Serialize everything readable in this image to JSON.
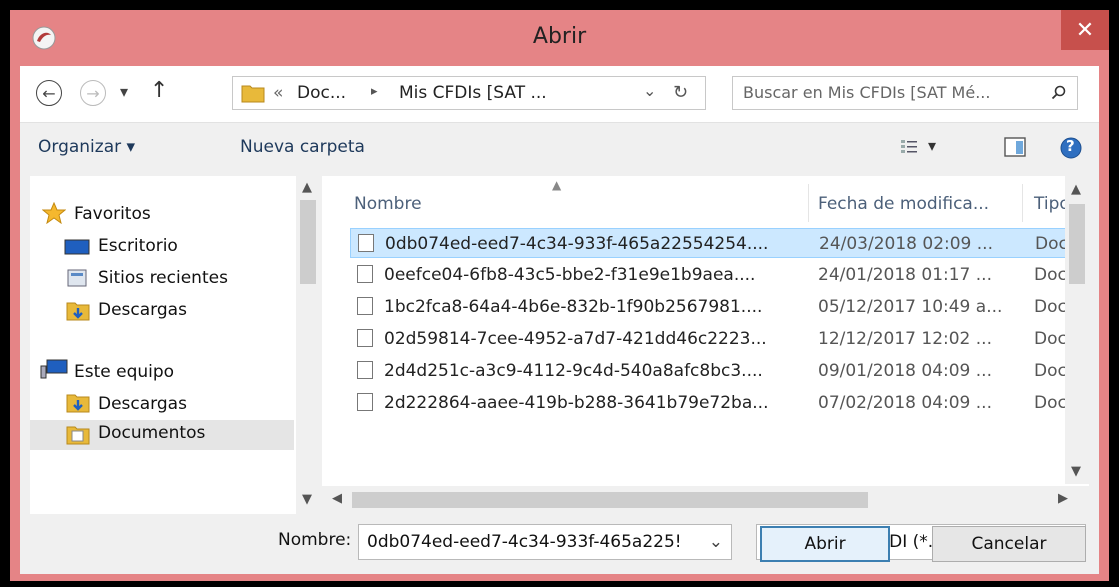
{
  "window": {
    "title": "Abrir",
    "close_glyph": "✕"
  },
  "nav": {
    "back_glyph": "←",
    "forward_glyph": "→",
    "recent_glyph": "▾",
    "up_glyph": "↑",
    "address_prefix": "«",
    "crumb1": "Doc...",
    "crumb_sep": "▸",
    "crumb2": "Mis CFDIs [SAT ...",
    "address_dropdown_glyph": "⌄",
    "refresh_glyph": "↻",
    "search_placeholder": "Buscar en Mis CFDIs [SAT Mé..."
  },
  "toolbar": {
    "organize_label": "Organizar ▾",
    "new_folder_label": "Nueva carpeta",
    "view_dropdown_glyph": "▾",
    "help_glyph": "?"
  },
  "sidebar": {
    "favorites": "Favoritos",
    "items": [
      {
        "label": "Escritorio"
      },
      {
        "label": "Sitios recientes"
      },
      {
        "label": "Descargas"
      }
    ],
    "computer": "Este equipo",
    "computer_items": [
      {
        "label": "Descargas"
      },
      {
        "label": "Documentos"
      }
    ]
  },
  "file_list": {
    "columns": {
      "name": "Nombre",
      "date": "Fecha de modifica...",
      "type": "Tipo"
    },
    "rows": [
      {
        "name": "0db074ed-eed7-4c34-933f-465a22554254....",
        "date": "24/03/2018 02:09 ...",
        "type": "Docun",
        "selected": true
      },
      {
        "name": "0eefce04-6fb8-43c5-bbe2-f31e9e1b9aea....",
        "date": "24/01/2018 01:17 ...",
        "type": "Docun",
        "selected": false
      },
      {
        "name": "1bc2fca8-64a4-4b6e-832b-1f90b2567981....",
        "date": "05/12/2017 10:49 a...",
        "type": "Docun",
        "selected": false
      },
      {
        "name": "02d59814-7cee-4952-a7d7-421dd46c2223...",
        "date": "12/12/2017 12:02 ...",
        "type": "Docun",
        "selected": false
      },
      {
        "name": "2d4d251c-a3c9-4112-9c4d-540a8afc8bc3....",
        "date": "09/01/2018 04:09 ...",
        "type": "Docun",
        "selected": false
      },
      {
        "name": "2d222864-aaee-419b-b288-3641b79e72ba...",
        "date": "07/02/2018 04:09 ...",
        "type": "Docun",
        "selected": false
      }
    ]
  },
  "footer": {
    "filename_label": "Nombre:",
    "filename_value": "0db074ed-eed7-4c34-933f-465a225!",
    "filter_value": "Archivos de CFDI (*.xml;*.cfdi)",
    "open_button": "Abrir",
    "cancel_button": "Cancelar"
  },
  "colors": {
    "titlebar": "#e58486",
    "close": "#c7504c",
    "selection": "#cce8ff",
    "link": "#1e395b"
  }
}
